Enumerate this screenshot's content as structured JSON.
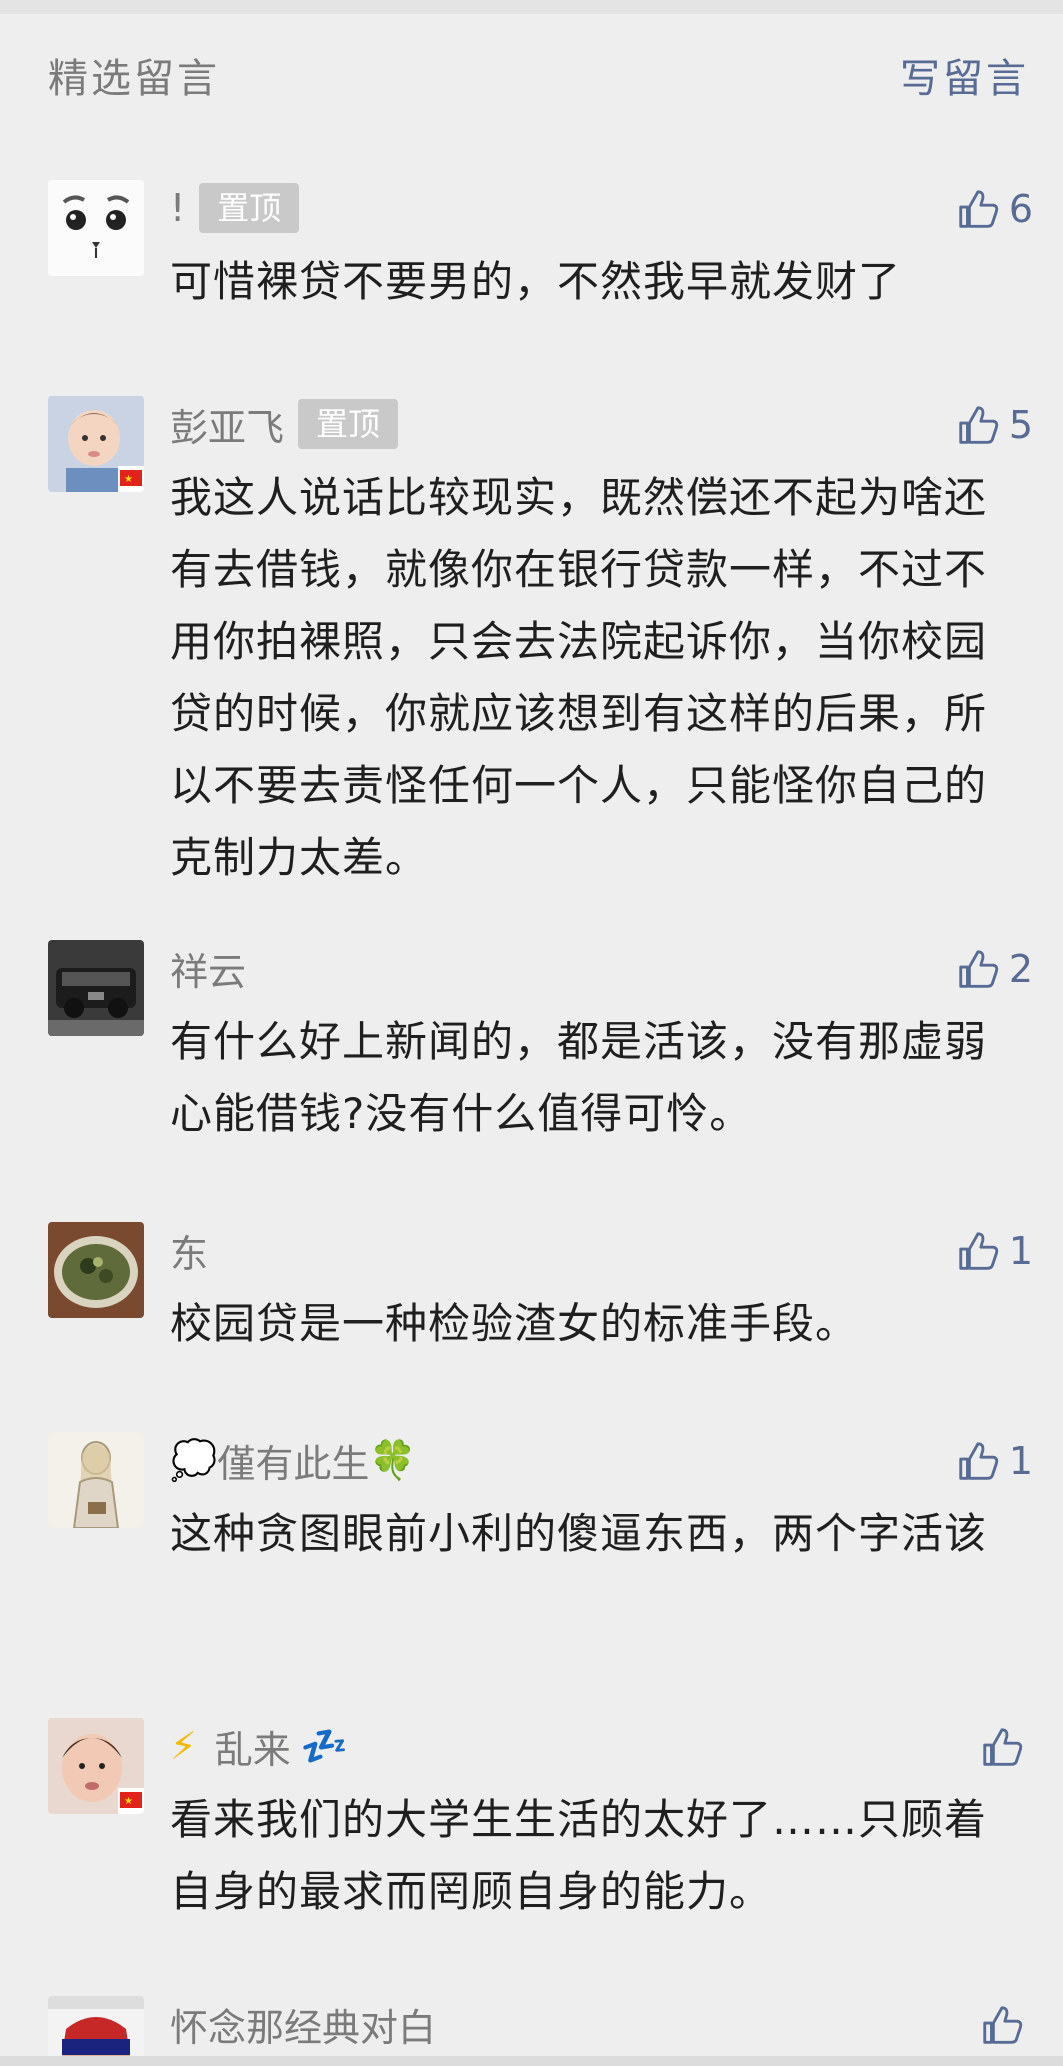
{
  "header": {
    "title": "精选留言",
    "write": "写留言"
  },
  "comments": [
    {
      "name": "!",
      "pinned": true,
      "pin_label": "置顶",
      "likes": "6",
      "text": "可惜裸贷不要男的，不然我早就发财了",
      "avatar": "dog-face-avatar"
    },
    {
      "name": "彭亚飞",
      "pinned": true,
      "pin_label": "置顶",
      "likes": "5",
      "text": "我这人说话比较现实，既然偿还不起为啥还有去借钱，就像你在银行贷款一样，不过不用你拍裸照，只会去法院起诉你，当你校园贷的时候，你就应该想到有这样的后果，所以不要去责怪任何一个人，只能怪你自己的克制力太差。",
      "avatar": "baby-photo-avatar"
    },
    {
      "name": "祥云",
      "likes": "2",
      "text": "有什么好上新闻的，都是活该，没有那虚弱心能借钱?没有什么值得可怜。",
      "avatar": "car-photo-avatar"
    },
    {
      "name": "东",
      "likes": "1",
      "text": "校园贷是一种检验渣女的标准手段。",
      "avatar": "soup-bowl-avatar"
    },
    {
      "name": "僅有此生",
      "name_prefix": "💭",
      "name_suffix": "🍀",
      "likes": "1",
      "text": "这种贪图眼前小利的傻逼东西，两个字活该",
      "avatar": "sketch-figure-avatar"
    },
    {
      "name": "乱来",
      "name_prefix": "⚡",
      "name_suffix": "💤",
      "likes": "",
      "text": "看来我们的大学生生活的太好了……只顾着自身的最求而罔顾自身的能力。",
      "avatar": "child-photo-avatar"
    },
    {
      "name": "怀念那经典对白",
      "likes": "",
      "text": "",
      "avatar": "colorful-avatar"
    }
  ],
  "colors": {
    "link": "#576b95",
    "meta": "#7b7b7b",
    "pin_bg": "#c9c9c9",
    "bg": "#eeeeee"
  }
}
